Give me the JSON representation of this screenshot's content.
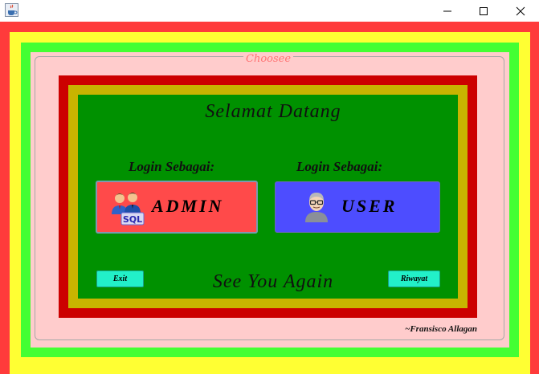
{
  "window": {
    "app_icon": "java-cup-icon",
    "minimize_icon": "minimize-icon",
    "maximize_icon": "maximize-icon",
    "close_icon": "close-icon"
  },
  "frame": {
    "title": "Choosee"
  },
  "main": {
    "welcome": "Selamat Datang",
    "admin": {
      "login_label": "Login Sebagai:",
      "button_label": "ADMIN",
      "icon": "admin-sql-icon"
    },
    "user": {
      "login_label": "Login Sebagai:",
      "button_label": "USER",
      "icon": "user-avatar-icon"
    },
    "exit_label": "Exit",
    "farewell": "See You Again",
    "history_label": "Riwayat"
  },
  "footer": {
    "author": "~Fransisco Allagan"
  },
  "colors": {
    "outer_red": "#ff3b3b",
    "yellow": "#ffff33",
    "lime": "#44ff33",
    "pink": "#ffcccc",
    "panel_red": "#cc0000",
    "panel_olive": "#c8b400",
    "panel_green": "#009100",
    "admin_button": "#ff4a4a",
    "user_button": "#4d4dff",
    "small_button": "#22f0c8"
  }
}
